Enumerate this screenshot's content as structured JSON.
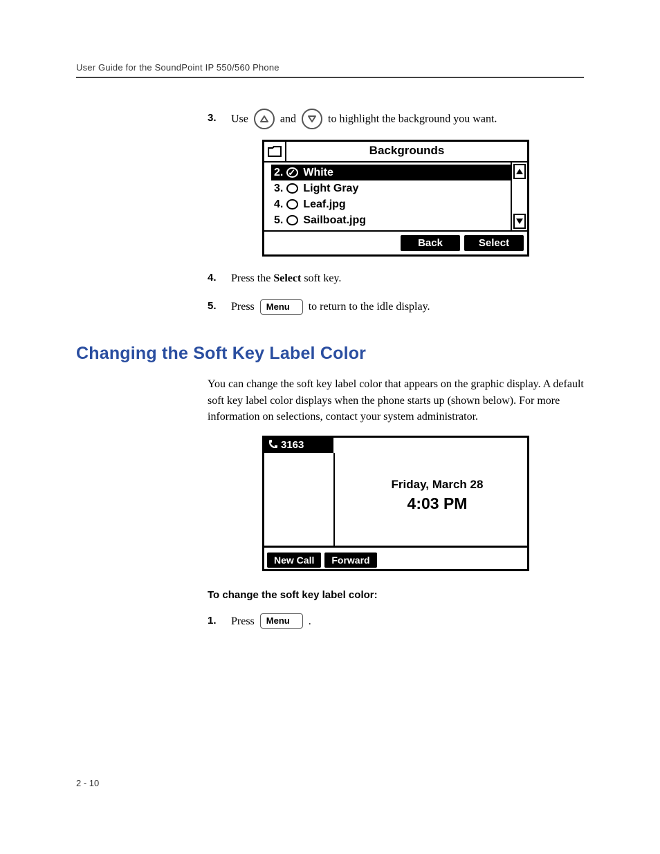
{
  "header": {
    "running_head": "User Guide for the SoundPoint IP 550/560 Phone"
  },
  "steps_a": {
    "s3": {
      "num": "3.",
      "pre": "Use",
      "mid": "and",
      "post": "to highlight the background you want."
    },
    "s4": {
      "num": "4.",
      "pre": "Press the ",
      "bold": "Select",
      "post": " soft key."
    },
    "s5": {
      "num": "5.",
      "pre": "Press",
      "btn": "Menu",
      "post": "to return to the idle display."
    }
  },
  "screen1": {
    "title": "Backgrounds",
    "items": [
      {
        "num": "2.",
        "label": "White",
        "selected": true,
        "checked": true
      },
      {
        "num": "3.",
        "label": "Light Gray",
        "selected": false,
        "checked": false
      },
      {
        "num": "4.",
        "label": "Leaf.jpg",
        "selected": false,
        "checked": false
      },
      {
        "num": "5.",
        "label": "Sailboat.jpg",
        "selected": false,
        "checked": false
      }
    ],
    "softkeys": {
      "back": "Back",
      "select": "Select"
    }
  },
  "section": {
    "title": "Changing the Soft Key Label Color",
    "para": "You can change the soft key label color that appears on the graphic display. A default soft key label color displays when the phone starts up (shown below). For more information on selections, contact your system administrator."
  },
  "screen2": {
    "ext": "3163",
    "date": "Friday, March 28",
    "time": "4:03 PM",
    "softkeys": {
      "newcall": "New Call",
      "forward": "Forward"
    }
  },
  "subheading": "To change the soft key label color:",
  "steps_b": {
    "s1": {
      "num": "1.",
      "pre": "Press",
      "btn": "Menu",
      "post": "."
    }
  },
  "footer": {
    "page": "2 - 10"
  }
}
